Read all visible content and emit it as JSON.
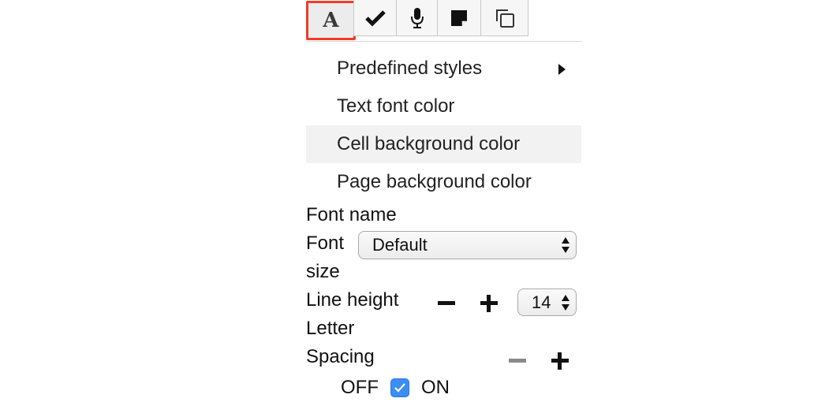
{
  "toolbar": {
    "buttons": [
      {
        "name": "font-style-icon",
        "glyph": "A",
        "active": true
      },
      {
        "name": "checkmark-icon"
      },
      {
        "name": "microphone-icon"
      },
      {
        "name": "sticky-note-icon"
      },
      {
        "name": "copy-icon"
      }
    ],
    "active_border_color": "#f23b24"
  },
  "menu": {
    "items": [
      {
        "label": "Predefined styles",
        "has_submenu": true
      },
      {
        "label": "Text font color"
      },
      {
        "label": "Cell background color",
        "hovered": true
      },
      {
        "label": "Page background color"
      }
    ]
  },
  "form": {
    "font_name_label": "Font name",
    "font_size_label_1": "Font",
    "font_size_label_2": "size",
    "font_select_value": "Default",
    "line_height_label": "Line height",
    "line_height_value": "14",
    "letter_spacing_label_1": "Letter",
    "letter_spacing_label_2": "Spacing",
    "off_label": "OFF",
    "on_label": "ON",
    "toggle_checked": true,
    "checkbox_color": "#3c8df6"
  }
}
